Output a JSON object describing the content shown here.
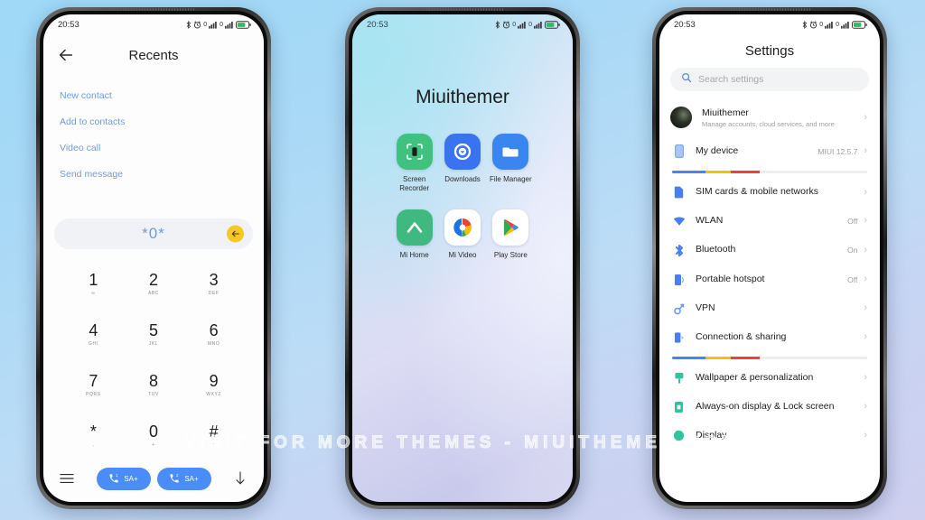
{
  "watermark": "VISIT FOR MORE THEMES - MIUITHEMER.COM",
  "status_bar": {
    "time": "20:53"
  },
  "phone_left": {
    "screen_name": "dialer-recents",
    "appbar": {
      "title": "Recents",
      "back_icon": "arrow-left-icon"
    },
    "actions": [
      {
        "label": "New contact"
      },
      {
        "label": "Add to contacts"
      },
      {
        "label": "Video call"
      },
      {
        "label": "Send message"
      }
    ],
    "dial_field": {
      "value": "*0*",
      "backspace_icon": "backspace-icon"
    },
    "keypad": [
      {
        "digit": "1",
        "letters": "∞"
      },
      {
        "digit": "2",
        "letters": "ABC"
      },
      {
        "digit": "3",
        "letters": "DEF"
      },
      {
        "digit": "4",
        "letters": "GHI"
      },
      {
        "digit": "5",
        "letters": "JKL"
      },
      {
        "digit": "6",
        "letters": "MNO"
      },
      {
        "digit": "7",
        "letters": "PQRS"
      },
      {
        "digit": "8",
        "letters": "TUV"
      },
      {
        "digit": "9",
        "letters": "WXYZ"
      },
      {
        "digit": "*",
        "letters": ","
      },
      {
        "digit": "0",
        "letters": "+"
      },
      {
        "digit": "#",
        "letters": ";"
      }
    ],
    "bottom": {
      "menu_icon": "menu-icon",
      "hide_icon": "chevron-down-icon",
      "call_buttons": [
        {
          "label": "SA+",
          "sim": "1",
          "icon": "phone-icon"
        },
        {
          "label": "SA+",
          "sim": "2",
          "icon": "phone-icon"
        }
      ],
      "accent": "#4b8df8"
    }
  },
  "phone_mid": {
    "screen_name": "home-screen",
    "title": "Miuithemer",
    "apps": [
      {
        "label": "Screen Recorder",
        "icon": "screen-recorder-icon",
        "bg": "#3fc27f"
      },
      {
        "label": "Downloads",
        "icon": "downloads-icon",
        "bg": "#3a73f0"
      },
      {
        "label": "File Manager",
        "icon": "file-manager-icon",
        "bg": "#3a86f0"
      },
      {
        "label": "Mi Home",
        "icon": "mi-home-icon",
        "bg": "#3fb980"
      },
      {
        "label": "Mi Video",
        "icon": "mi-video-icon",
        "bg": "#ffffff"
      },
      {
        "label": "Play Store",
        "icon": "play-store-icon",
        "bg": "#ffffff"
      }
    ]
  },
  "phone_right": {
    "screen_name": "settings",
    "title": "Settings",
    "search": {
      "placeholder": "Search settings",
      "icon": "search-icon"
    },
    "account": {
      "name": "Miuithemer",
      "subtitle": "Manage accounts, cloud services, and more",
      "avatar": "avatar"
    },
    "items": [
      {
        "label": "My device",
        "value": "MIUI 12.5.7",
        "icon": "device-icon",
        "color": "#7aa6f5"
      },
      {
        "divider": true
      },
      {
        "label": "SIM cards & mobile networks",
        "value": "",
        "icon": "sim-icon",
        "color": "#4a7ef0"
      },
      {
        "label": "WLAN",
        "value": "Off",
        "icon": "wifi-icon",
        "color": "#4a7ef0"
      },
      {
        "label": "Bluetooth",
        "value": "On",
        "icon": "bluetooth-icon",
        "color": "#4a7ef0"
      },
      {
        "label": "Portable hotspot",
        "value": "Off",
        "icon": "hotspot-icon",
        "color": "#4a7ef0"
      },
      {
        "label": "VPN",
        "value": "",
        "icon": "vpn-icon",
        "color": "#6e9af3"
      },
      {
        "label": "Connection & sharing",
        "value": "",
        "icon": "sharing-icon",
        "color": "#4a7ef0"
      },
      {
        "divider": true
      },
      {
        "label": "Wallpaper & personalization",
        "value": "",
        "icon": "wallpaper-icon",
        "color": "#2ec4a0"
      },
      {
        "label": "Always-on display & Lock screen",
        "value": "",
        "icon": "lockscreen-icon",
        "color": "#2ec4a0"
      },
      {
        "label": "Display",
        "value": "",
        "icon": "display-icon",
        "color": "#2ec4a0"
      }
    ],
    "divider_colors": {
      "blue": "#4285f4",
      "yellow": "#fbbc05",
      "red": "#ea4335"
    }
  }
}
